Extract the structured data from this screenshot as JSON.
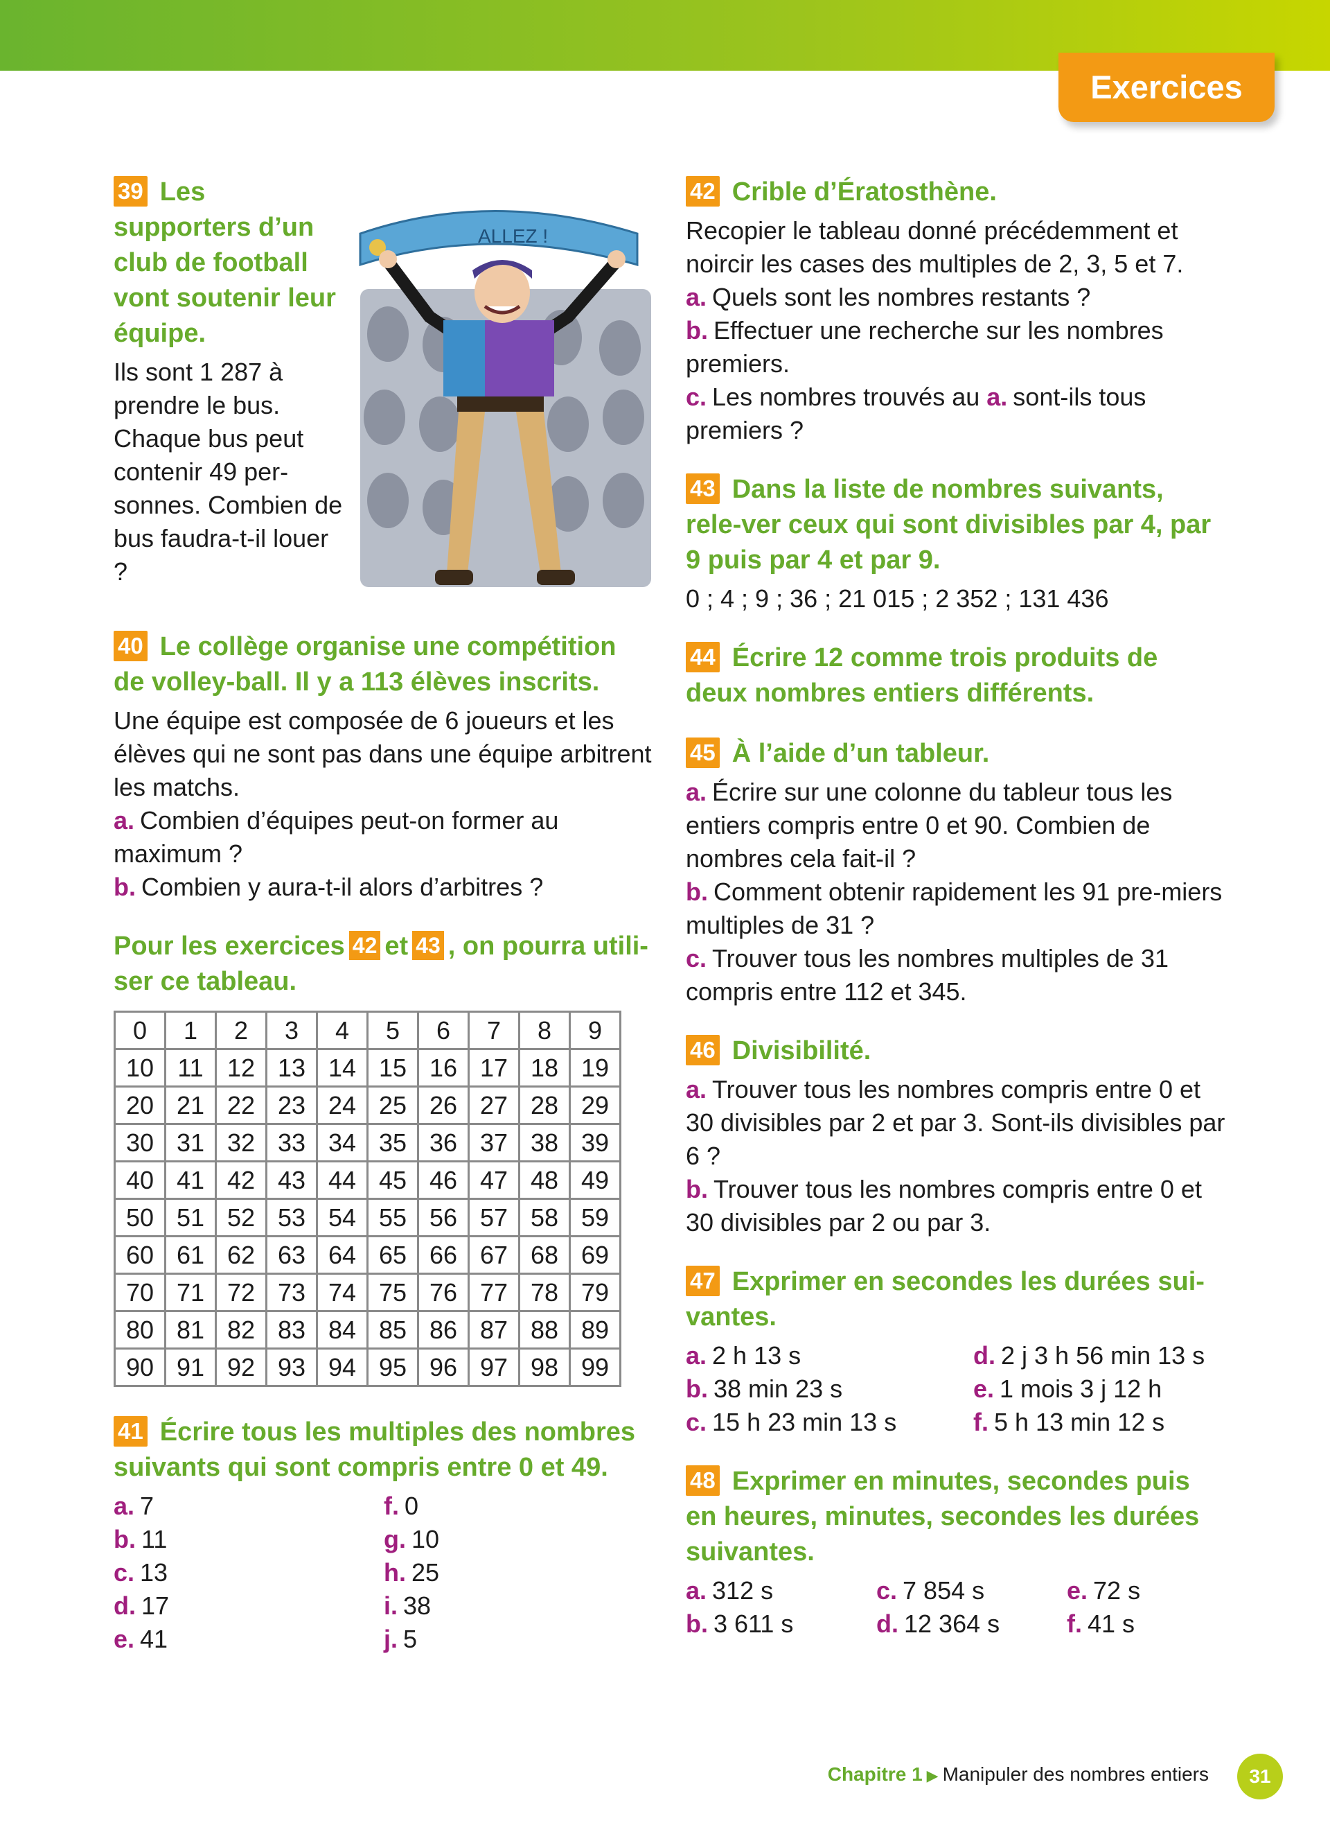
{
  "header": {
    "tab_label": "Exercices"
  },
  "ex39": {
    "num": "39",
    "title": "Les supporters d’un club de football vont soutenir leur équipe.",
    "text": "Ils sont 1 287 à prendre le bus. Chaque bus peut contenir 49 per-sonnes. Combien de bus faudra-t-il louer ?",
    "banner_text": "ALLEZ !"
  },
  "ex40": {
    "num": "40",
    "title": "Le collège organise une compétition de volley-ball. Il y a 113 élèves inscrits.",
    "text": "Une équipe est composée de 6 joueurs et les élèves qui ne sont pas dans une équipe arbitrent les matchs.",
    "a_label": "a.",
    "a_text": "Combien d’équipes peut-on former au maximum ?",
    "b_label": "b.",
    "b_text": "Combien y aura-t-il alors d’arbitres ?"
  },
  "table_intro": {
    "before": "Pour les exercices",
    "ref1": "42",
    "mid": "et",
    "ref2": "43",
    "after": ", on pourra utili-ser ce tableau."
  },
  "number_table": [
    [
      "0",
      "1",
      "2",
      "3",
      "4",
      "5",
      "6",
      "7",
      "8",
      "9"
    ],
    [
      "10",
      "11",
      "12",
      "13",
      "14",
      "15",
      "16",
      "17",
      "18",
      "19"
    ],
    [
      "20",
      "21",
      "22",
      "23",
      "24",
      "25",
      "26",
      "27",
      "28",
      "29"
    ],
    [
      "30",
      "31",
      "32",
      "33",
      "34",
      "35",
      "36",
      "37",
      "38",
      "39"
    ],
    [
      "40",
      "41",
      "42",
      "43",
      "44",
      "45",
      "46",
      "47",
      "48",
      "49"
    ],
    [
      "50",
      "51",
      "52",
      "53",
      "54",
      "55",
      "56",
      "57",
      "58",
      "59"
    ],
    [
      "60",
      "61",
      "62",
      "63",
      "64",
      "65",
      "66",
      "67",
      "68",
      "69"
    ],
    [
      "70",
      "71",
      "72",
      "73",
      "74",
      "75",
      "76",
      "77",
      "78",
      "79"
    ],
    [
      "80",
      "81",
      "82",
      "83",
      "84",
      "85",
      "86",
      "87",
      "88",
      "89"
    ],
    [
      "90",
      "91",
      "92",
      "93",
      "94",
      "95",
      "96",
      "97",
      "98",
      "99"
    ]
  ],
  "ex41": {
    "num": "41",
    "title": "Écrire tous les multiples des nombres suivants qui sont compris entre 0 et 49.",
    "items": [
      {
        "l": "a.",
        "v": "7"
      },
      {
        "l": "f.",
        "v": "0"
      },
      {
        "l": "b.",
        "v": "11"
      },
      {
        "l": "g.",
        "v": "10"
      },
      {
        "l": "c.",
        "v": "13"
      },
      {
        "l": "h.",
        "v": "25"
      },
      {
        "l": "d.",
        "v": "17"
      },
      {
        "l": "i.",
        "v": "38"
      },
      {
        "l": "e.",
        "v": "41"
      },
      {
        "l": "j.",
        "v": "5"
      }
    ]
  },
  "ex42": {
    "num": "42",
    "title": "Crible d’Ératosthène.",
    "text": "Recopier le tableau donné précédemment et noircir les cases des multiples de 2, 3, 5 et 7.",
    "a_label": "a.",
    "a_text": "Quels sont les nombres restants ?",
    "b_label": "b.",
    "b_text": "Effectuer une recherche sur les nombres premiers.",
    "c_label": "c.",
    "c_text_1": "Les nombres trouvés au",
    "c_ref": "a.",
    "c_text_2": "sont-ils tous premiers ?"
  },
  "ex43": {
    "num": "43",
    "title": "Dans la liste de nombres suivants, rele-ver ceux qui sont divisibles par 4, par 9 puis par 4 et par 9.",
    "list": "0 ; 4 ; 9 ; 36 ; 21 015 ; 2 352 ; 131 436"
  },
  "ex44": {
    "num": "44",
    "title": "Écrire 12 comme trois produits de deux nombres entiers différents."
  },
  "ex45": {
    "num": "45",
    "title": "À l’aide d’un tableur.",
    "a_label": "a.",
    "a_text": "Écrire sur une colonne du tableur tous les entiers compris entre 0 et 90. Combien de nombres cela fait-il ?",
    "b_label": "b.",
    "b_text": "Comment obtenir rapidement les 91 pre-miers multiples de 31 ?",
    "c_label": "c.",
    "c_text": "Trouver tous les nombres multiples de 31 compris entre 112 et 345."
  },
  "ex46": {
    "num": "46",
    "title": "Divisibilité.",
    "a_label": "a.",
    "a_text": "Trouver tous les nombres compris entre 0 et 30 divisibles par 2 et par 3. Sont-ils divisibles par 6 ?",
    "b_label": "b.",
    "b_text": "Trouver tous les nombres compris entre 0 et 30 divisibles par 2 ou par 3."
  },
  "ex47": {
    "num": "47",
    "title": "Exprimer en secondes les durées sui-vantes.",
    "items": [
      {
        "l": "a.",
        "v": "2 h 13 s"
      },
      {
        "l": "d.",
        "v": "2 j 3 h 56 min 13 s"
      },
      {
        "l": "b.",
        "v": "38 min 23 s"
      },
      {
        "l": "e.",
        "v": "1 mois 3 j 12 h"
      },
      {
        "l": "c.",
        "v": "15 h 23 min 13 s"
      },
      {
        "l": "f.",
        "v": "5 h 13 min 12 s"
      }
    ]
  },
  "ex48": {
    "num": "48",
    "title": "Exprimer en minutes, secondes puis en heures, minutes, secondes les durées suivantes.",
    "items": [
      {
        "l": "a.",
        "v": "312 s"
      },
      {
        "l": "c.",
        "v": "7 854 s"
      },
      {
        "l": "e.",
        "v": "72 s"
      },
      {
        "l": "b.",
        "v": "3 611 s"
      },
      {
        "l": "d.",
        "v": "12 364 s"
      },
      {
        "l": "f.",
        "v": "41 s"
      }
    ]
  },
  "footer": {
    "chapter": "Chapitre 1",
    "title": "Manipuler des nombres entiers",
    "page": "31"
  },
  "colors": {
    "green": "#67ab2c",
    "orange": "#f39a14",
    "purple": "#a01f7e"
  }
}
